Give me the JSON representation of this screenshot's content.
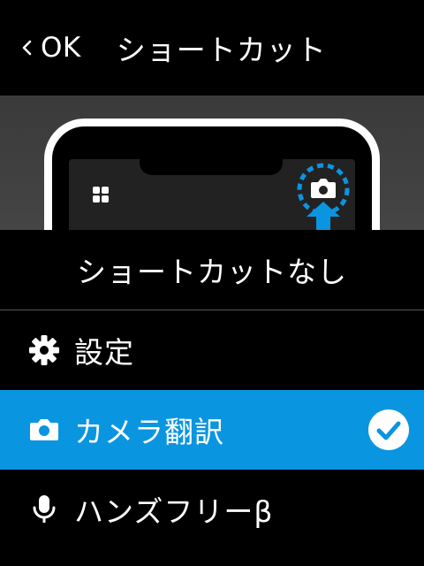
{
  "header": {
    "back_label": "OK",
    "title": "ショートカット"
  },
  "options": {
    "none_label": "ショートカットなし",
    "items": [
      {
        "label": "設定",
        "icon": "gear-icon"
      },
      {
        "label": "カメラ翻訳",
        "icon": "camera-icon",
        "selected": true
      },
      {
        "label": "ハンズフリーβ",
        "icon": "microphone-icon"
      }
    ]
  },
  "colors": {
    "accent": "#0a95e0",
    "background": "#000000"
  }
}
